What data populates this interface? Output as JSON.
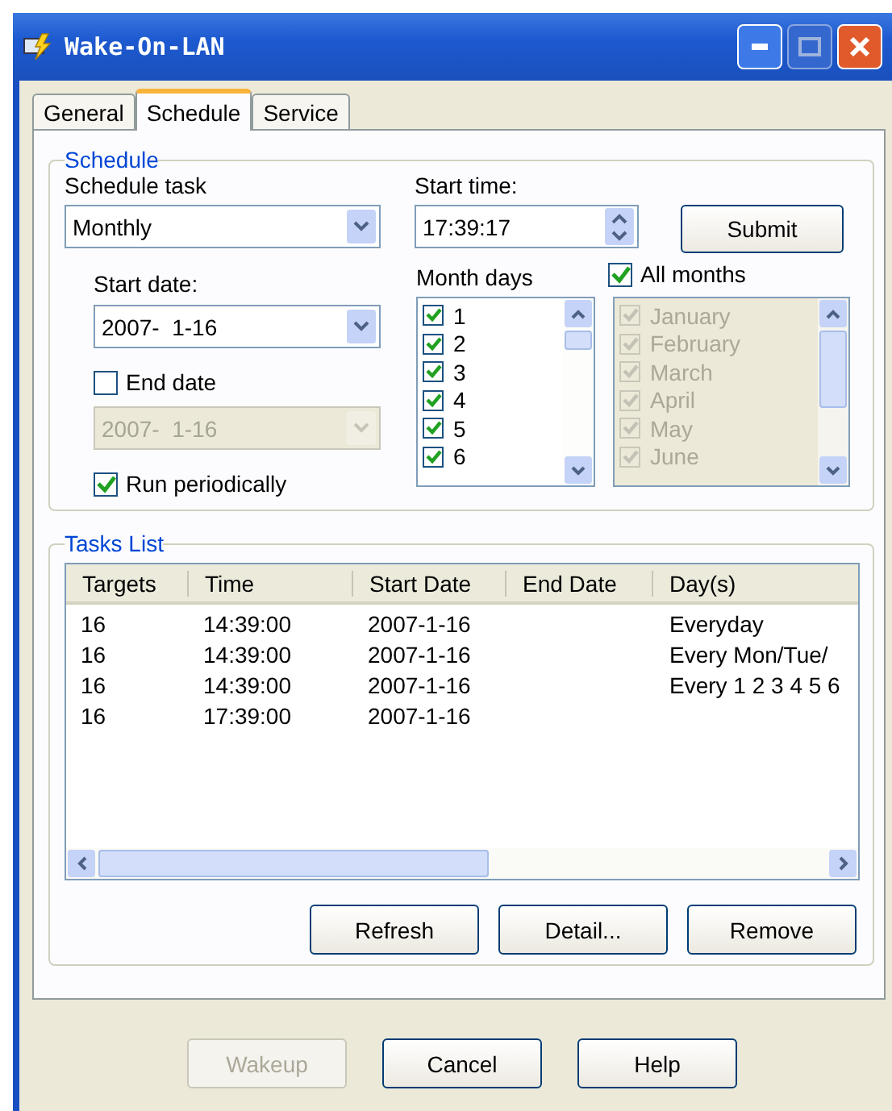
{
  "window": {
    "title": "Wake-On-LAN"
  },
  "tabs": [
    {
      "label": "General",
      "selected": false
    },
    {
      "label": "Schedule",
      "selected": true
    },
    {
      "label": "Service",
      "selected": false
    }
  ],
  "schedule": {
    "title": "Schedule",
    "schedule_task": {
      "label": "Schedule task",
      "value": "Monthly"
    },
    "start_time": {
      "label": "Start time:",
      "value": "17:39:17"
    },
    "submit": "Submit",
    "start_date": {
      "label": "Start date:",
      "value": "2007-  1-16"
    },
    "end_date": {
      "label": "End date",
      "checked": false,
      "value": "2007-  1-16",
      "disabled": true
    },
    "run_periodically": {
      "label": "Run periodically",
      "checked": true
    },
    "month_days": {
      "label": "Month days",
      "items": [
        {
          "label": "1",
          "checked": true
        },
        {
          "label": "2",
          "checked": true
        },
        {
          "label": "3",
          "checked": true
        },
        {
          "label": "4",
          "checked": true
        },
        {
          "label": "5",
          "checked": true
        },
        {
          "label": "6",
          "checked": true
        }
      ]
    },
    "all_months": {
      "label": "All months",
      "checked": true
    },
    "months": {
      "disabled": true,
      "items": [
        {
          "label": "January",
          "checked": true
        },
        {
          "label": "February",
          "checked": true
        },
        {
          "label": "March",
          "checked": true
        },
        {
          "label": "April",
          "checked": true
        },
        {
          "label": "May",
          "checked": true
        },
        {
          "label": "June",
          "checked": true
        }
      ]
    }
  },
  "tasks": {
    "title": "Tasks List",
    "columns": [
      "Targets",
      "Time",
      "Start Date",
      "End Date",
      "Day(s)"
    ],
    "rows": [
      [
        "16",
        "14:39:00",
        "2007-1-16",
        "",
        "Everyday"
      ],
      [
        "16",
        "14:39:00",
        "2007-1-16",
        "",
        "Every Mon/Tue/"
      ],
      [
        "16",
        "14:39:00",
        "2007-1-16",
        "",
        "Every 1 2 3 4 5 6"
      ],
      [
        "16",
        "17:39:00",
        "2007-1-16",
        "",
        ""
      ]
    ],
    "buttons": [
      "Refresh",
      "Detail...",
      "Remove"
    ]
  },
  "footer_buttons": [
    {
      "label": "Wakeup",
      "disabled": true
    },
    {
      "label": "Cancel",
      "disabled": false
    },
    {
      "label": "Help",
      "disabled": false
    }
  ]
}
